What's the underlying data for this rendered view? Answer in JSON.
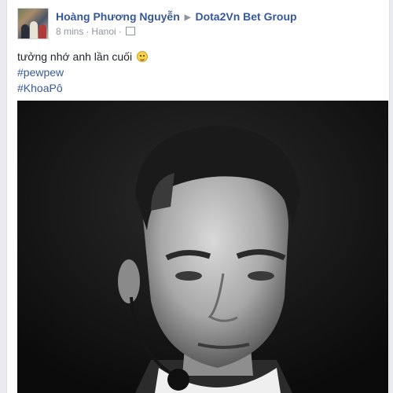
{
  "post": {
    "author": "Hoàng Phương Nguyễn",
    "group": "Dota2Vn Bet Group",
    "time": "8 mins",
    "location": "Hanoi",
    "text": "tưởng nhớ anh lần cuối",
    "hashtags": [
      "#pewpew",
      "#KhoaPô"
    ],
    "icons": {
      "arrow": "triangle-right-icon",
      "audience": "group-audience-icon",
      "emoji": "smile-emoji-icon"
    }
  }
}
